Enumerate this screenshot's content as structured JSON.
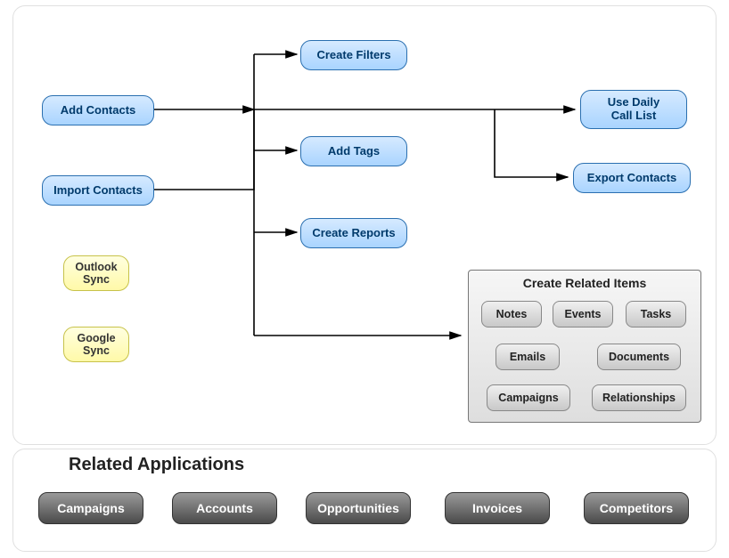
{
  "flow_nodes": {
    "add_contacts": "Add Contacts",
    "import_contacts": "Import Contacts",
    "create_filters": "Create Filters",
    "add_tags": "Add Tags",
    "create_reports": "Create Reports",
    "use_daily_call_list": "Use Daily\nCall List",
    "export_contacts": "Export Contacts"
  },
  "sync_nodes": {
    "outlook": "Outlook\nSync",
    "google": "Google\nSync"
  },
  "related_items": {
    "title": "Create Related Items",
    "items": {
      "notes": "Notes",
      "events": "Events",
      "tasks": "Tasks",
      "emails": "Emails",
      "documents": "Documents",
      "campaigns": "Campaigns",
      "relationships": "Relationships"
    }
  },
  "related_apps": {
    "title": "Related Applications",
    "items": {
      "campaigns": "Campaigns",
      "accounts": "Accounts",
      "opportunities": "Opportunities",
      "invoices": "Invoices",
      "competitors": "Competitors"
    }
  }
}
